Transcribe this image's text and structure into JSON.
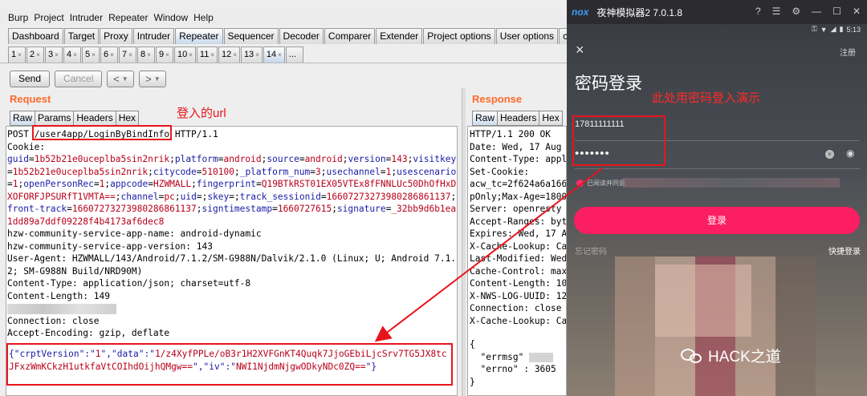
{
  "burp": {
    "menu": [
      "Burp",
      "Project",
      "Intruder",
      "Repeater",
      "Window",
      "Help"
    ],
    "tools": [
      "Dashboard",
      "Target",
      "Proxy",
      "Intruder",
      "Repeater",
      "Sequencer",
      "Decoder",
      "Comparer",
      "Extender",
      "Project options",
      "User options",
      "captcha-kil"
    ],
    "active_tool": "Repeater",
    "request_tabs": [
      "1",
      "2",
      "3",
      "4",
      "5",
      "6",
      "7",
      "8",
      "9",
      "10",
      "11",
      "12",
      "13",
      "14",
      "..."
    ],
    "active_request_tab": "14",
    "send_label": "Send",
    "cancel_label": "Cancel",
    "back_label": "<",
    "forward_label": ">",
    "request_title": "Request",
    "response_title": "Response",
    "request_subtabs": [
      "Raw",
      "Params",
      "Headers",
      "Hex"
    ],
    "response_subtabs": [
      "Raw",
      "Headers",
      "Hex"
    ],
    "request": {
      "method": "POST ",
      "path": "/user4app/LoginByBindInfo",
      "protocol": " HTTP/1.1",
      "cookie_label": "Cookie:",
      "cookies": [
        [
          "guid",
          "1b52b21e0uceplba5sin2nrik"
        ],
        [
          "platform",
          "android"
        ],
        [
          "source",
          "android"
        ],
        [
          "version",
          "143"
        ],
        [
          "visitkey",
          "1b52b21e0uceplba5sin2nrik"
        ],
        [
          "citycode",
          "510100"
        ],
        [
          "_platform_num",
          "3"
        ],
        [
          "usechannel",
          "1"
        ],
        [
          "usescenario",
          "1"
        ],
        [
          "openPersonRec",
          "1"
        ],
        [
          "appcode",
          "HZWMALL"
        ],
        [
          "fingerprint",
          "Q19BTkRST01EX05VTEx8fFNNLUc50DhOfHxDXOFORFJPSURfT1VMTA=="
        ],
        [
          "channel",
          "pc"
        ],
        [
          "uid",
          ""
        ],
        [
          "skey",
          ""
        ],
        [
          "track_sessionid",
          "16607273273980286861137"
        ],
        [
          "front-track",
          "16607273273980286861137"
        ],
        [
          "signtimestamp",
          "1660727615"
        ],
        [
          "signature",
          "_32bb9d6b1ea1dd89a7ddf09228f4b4173af6dec8"
        ]
      ],
      "headers": [
        "hzw-community-service-app-name: android-dynamic",
        "hzw-community-service-app-version: 143",
        "User-Agent: HZWMALL/143/Android/7.1.2/SM-G988N/Dalvik/2.1.0 (Linux; U; Android 7.1.2; SM-G988N Build/NRD90M)",
        "Content-Type: application/json; charset=utf-8",
        "Content-Length: 149"
      ],
      "headers_after": [
        "Connection: close",
        "Accept-Encoding: gzip, deflate"
      ],
      "body_parts": [
        [
          "{\"",
          "k"
        ],
        [
          "crptVersion",
          "k"
        ],
        [
          "\":\"",
          "k"
        ],
        [
          "1",
          "v"
        ],
        [
          "\",\"",
          "k"
        ],
        [
          "data",
          "k"
        ],
        [
          "\":\"",
          "k"
        ],
        [
          "1/z4XyfPPLe/oB3r1H2XVFGnKT4Quqk7JjoGEbiLjcSrv7TG5JX8tcJFxzWmKCkzH1utkfaVtCOIhdOijhQMgw==",
          "v"
        ],
        [
          "\",\"",
          "k"
        ],
        [
          "iv",
          "k"
        ],
        [
          "\":\"",
          "k"
        ],
        [
          "NWI1NjdmNjgwODkyNDc0ZQ==",
          "v"
        ],
        [
          "\"}",
          "k"
        ]
      ]
    },
    "response": {
      "lines": [
        "HTTP/1.1 200 OK",
        "Date: Wed, 17 Aug",
        "Content-Type: appl",
        "Set-Cookie:",
        "acw_tc=2f624a6a166",
        "pOnly;Max-Age=1800",
        "Server: openresty",
        "Accept-Ranges: byt",
        "Expires: Wed, 17 A",
        "X-Cache-Lookup: Ca",
        "Last-Modified: Wed",
        "Cache-Control: max",
        "Content-Length: 10",
        "X-NWS-LOG-UUID: 12",
        "Connection: close",
        "X-Cache-Lookup: Ca"
      ],
      "json_open": "{",
      "errmsg_line": "  \"errmsg\"",
      "errno_line": "  \"errno\" : 3605",
      "json_close": "}"
    },
    "annotation_url": "登入的url"
  },
  "emulator": {
    "logo": "nox",
    "title": "夜神模拟器2 7.0.1.8",
    "controls": [
      "?",
      "☰",
      "⚙",
      "—",
      "☐",
      "✕"
    ],
    "status_time": "5:13",
    "close_icon": "×",
    "register": "注册",
    "page_title": "密码登录",
    "annotation": "此处用密码登入演示",
    "phone": "17811111111",
    "password_mask": "•••••••",
    "agree_text": "已阅读并同意",
    "login_button": "登录",
    "forgot": "忘记密码",
    "quick_login": "快捷登录"
  },
  "watermark": "HACK之道",
  "colors": {
    "burp_accent": "#ff6a2a",
    "annotation_red": "#e8141c",
    "login_pink": "#fb1e63",
    "key_blue": "#1a1aa6",
    "value_red": "#b8001a"
  }
}
